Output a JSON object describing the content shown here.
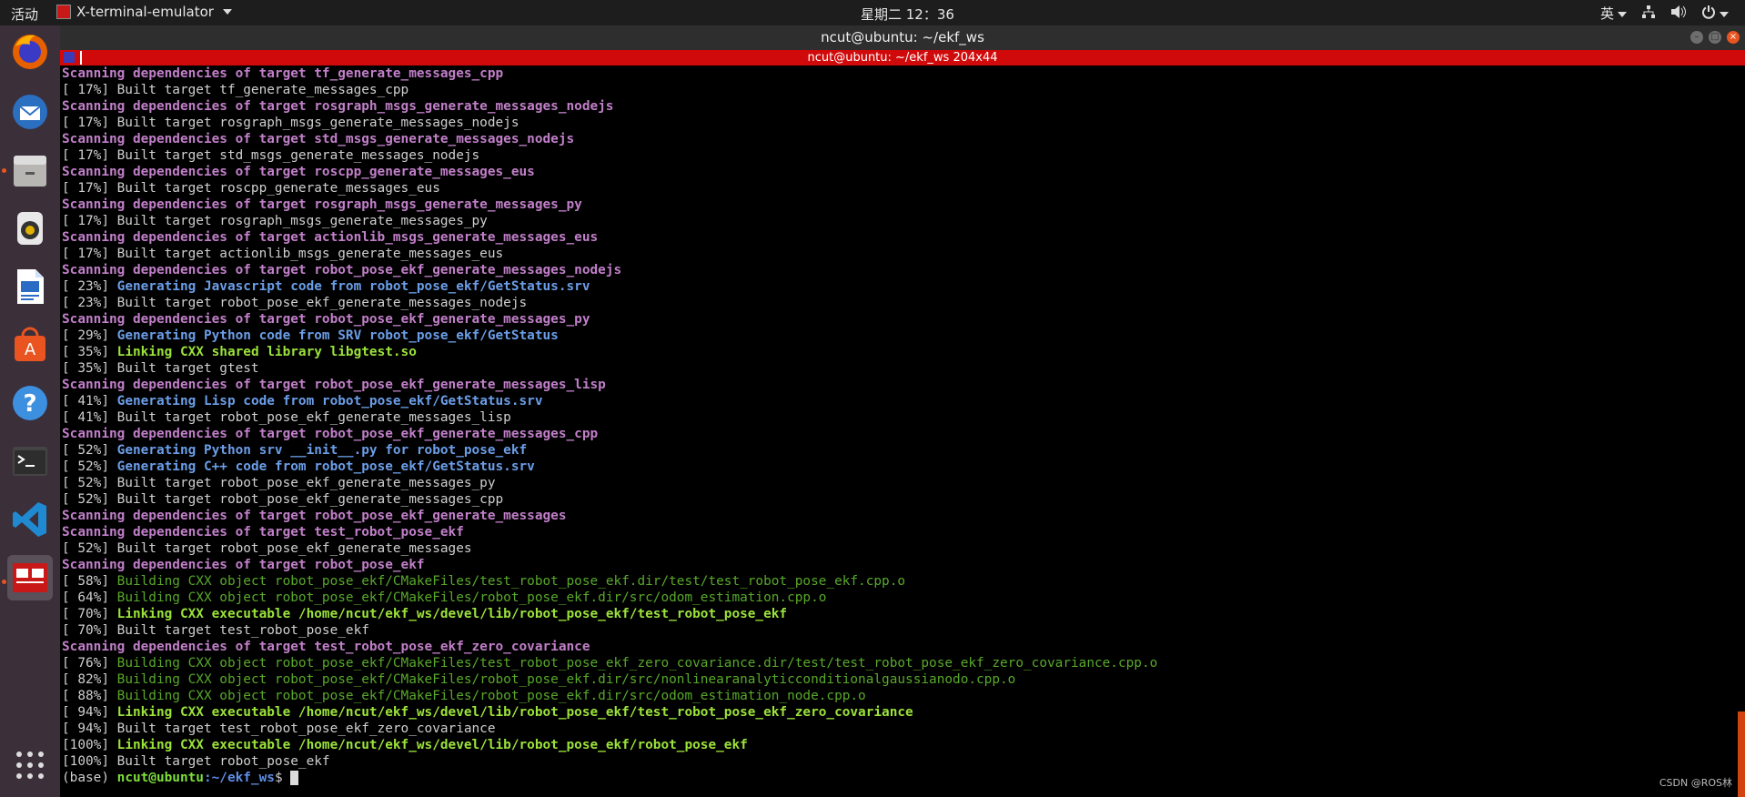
{
  "topbar": {
    "activities": "活动",
    "app_name": "X-terminal-emulator",
    "clock": "星期二 12：36",
    "input_method": "英"
  },
  "dock": {
    "items": [
      {
        "name": "firefox-icon",
        "running": false,
        "active": false
      },
      {
        "name": "thunderbird-icon",
        "running": false,
        "active": false
      },
      {
        "name": "files-icon",
        "running": true,
        "active": false
      },
      {
        "name": "rhythmbox-icon",
        "running": false,
        "active": false
      },
      {
        "name": "writer-icon",
        "running": false,
        "active": false
      },
      {
        "name": "software-icon",
        "running": false,
        "active": false
      },
      {
        "name": "help-icon",
        "running": false,
        "active": false
      },
      {
        "name": "terminal-icon",
        "running": false,
        "active": false
      },
      {
        "name": "vscode-icon",
        "running": false,
        "active": false
      },
      {
        "name": "xterm-icon",
        "running": true,
        "active": true
      }
    ],
    "apps_grid": "apps-grid-icon"
  },
  "window": {
    "title": "ncut@ubuntu: ~/ekf_ws",
    "xterm_title": "ncut@ubuntu: ~/ekf_ws 204x44"
  },
  "terminal": {
    "lines": [
      [
        {
          "t": "Scanning dependencies of target tf_generate_messages_cpp",
          "c": "scan"
        }
      ],
      [
        {
          "t": "[ 17%] Built target tf_generate_messages_cpp",
          "c": "plain"
        }
      ],
      [
        {
          "t": "Scanning dependencies of target rosgraph_msgs_generate_messages_nodejs",
          "c": "scan"
        }
      ],
      [
        {
          "t": "[ 17%] Built target rosgraph_msgs_generate_messages_nodejs",
          "c": "plain"
        }
      ],
      [
        {
          "t": "Scanning dependencies of target std_msgs_generate_messages_nodejs",
          "c": "scan"
        }
      ],
      [
        {
          "t": "[ 17%] Built target std_msgs_generate_messages_nodejs",
          "c": "plain"
        }
      ],
      [
        {
          "t": "Scanning dependencies of target roscpp_generate_messages_eus",
          "c": "scan"
        }
      ],
      [
        {
          "t": "[ 17%] Built target roscpp_generate_messages_eus",
          "c": "plain"
        }
      ],
      [
        {
          "t": "Scanning dependencies of target rosgraph_msgs_generate_messages_py",
          "c": "scan"
        }
      ],
      [
        {
          "t": "[ 17%] Built target rosgraph_msgs_generate_messages_py",
          "c": "plain"
        }
      ],
      [
        {
          "t": "Scanning dependencies of target actionlib_msgs_generate_messages_eus",
          "c": "scan"
        }
      ],
      [
        {
          "t": "[ 17%] Built target actionlib_msgs_generate_messages_eus",
          "c": "plain"
        }
      ],
      [
        {
          "t": "Scanning dependencies of target robot_pose_ekf_generate_messages_nodejs",
          "c": "scan"
        }
      ],
      [
        {
          "t": "[ 23%] ",
          "c": "plain"
        },
        {
          "t": "Generating Javascript code from robot_pose_ekf/GetStatus.srv",
          "c": "gen"
        }
      ],
      [
        {
          "t": "[ 23%] Built target robot_pose_ekf_generate_messages_nodejs",
          "c": "plain"
        }
      ],
      [
        {
          "t": "Scanning dependencies of target robot_pose_ekf_generate_messages_py",
          "c": "scan"
        }
      ],
      [
        {
          "t": "[ 29%] ",
          "c": "plain"
        },
        {
          "t": "Generating Python code from SRV robot_pose_ekf/GetStatus",
          "c": "gen"
        }
      ],
      [
        {
          "t": "[ 35%] ",
          "c": "plain"
        },
        {
          "t": "Linking CXX shared library libgtest.so",
          "c": "link"
        }
      ],
      [
        {
          "t": "[ 35%] Built target gtest",
          "c": "plain"
        }
      ],
      [
        {
          "t": "Scanning dependencies of target robot_pose_ekf_generate_messages_lisp",
          "c": "scan"
        }
      ],
      [
        {
          "t": "[ 41%] ",
          "c": "plain"
        },
        {
          "t": "Generating Lisp code from robot_pose_ekf/GetStatus.srv",
          "c": "gen"
        }
      ],
      [
        {
          "t": "[ 41%] Built target robot_pose_ekf_generate_messages_lisp",
          "c": "plain"
        }
      ],
      [
        {
          "t": "Scanning dependencies of target robot_pose_ekf_generate_messages_cpp",
          "c": "scan"
        }
      ],
      [
        {
          "t": "[ 52%] ",
          "c": "plain"
        },
        {
          "t": "Generating Python srv __init__.py for robot_pose_ekf",
          "c": "gen"
        }
      ],
      [
        {
          "t": "[ 52%] ",
          "c": "plain"
        },
        {
          "t": "Generating C++ code from robot_pose_ekf/GetStatus.srv",
          "c": "gen"
        }
      ],
      [
        {
          "t": "[ 52%] Built target robot_pose_ekf_generate_messages_py",
          "c": "plain"
        }
      ],
      [
        {
          "t": "[ 52%] Built target robot_pose_ekf_generate_messages_cpp",
          "c": "plain"
        }
      ],
      [
        {
          "t": "Scanning dependencies of target robot_pose_ekf_generate_messages",
          "c": "scan"
        }
      ],
      [
        {
          "t": "Scanning dependencies of target test_robot_pose_ekf",
          "c": "scan"
        }
      ],
      [
        {
          "t": "[ 52%] Built target robot_pose_ekf_generate_messages",
          "c": "plain"
        }
      ],
      [
        {
          "t": "Scanning dependencies of target robot_pose_ekf",
          "c": "scan"
        }
      ],
      [
        {
          "t": "[ 58%] ",
          "c": "plain"
        },
        {
          "t": "Building CXX object robot_pose_ekf/CMakeFiles/test_robot_pose_ekf.dir/test/test_robot_pose_ekf.cpp.o",
          "c": "build"
        }
      ],
      [
        {
          "t": "[ 64%] ",
          "c": "plain"
        },
        {
          "t": "Building CXX object robot_pose_ekf/CMakeFiles/robot_pose_ekf.dir/src/odom_estimation.cpp.o",
          "c": "build"
        }
      ],
      [
        {
          "t": "[ 70%] ",
          "c": "plain"
        },
        {
          "t": "Linking CXX executable /home/ncut/ekf_ws/devel/lib/robot_pose_ekf/test_robot_pose_ekf",
          "c": "link"
        }
      ],
      [
        {
          "t": "[ 70%] Built target test_robot_pose_ekf",
          "c": "plain"
        }
      ],
      [
        {
          "t": "Scanning dependencies of target test_robot_pose_ekf_zero_covariance",
          "c": "scan"
        }
      ],
      [
        {
          "t": "[ 76%] ",
          "c": "plain"
        },
        {
          "t": "Building CXX object robot_pose_ekf/CMakeFiles/test_robot_pose_ekf_zero_covariance.dir/test/test_robot_pose_ekf_zero_covariance.cpp.o",
          "c": "build"
        }
      ],
      [
        {
          "t": "[ 82%] ",
          "c": "plain"
        },
        {
          "t": "Building CXX object robot_pose_ekf/CMakeFiles/robot_pose_ekf.dir/src/nonlinearanalyticconditionalgaussianodo.cpp.o",
          "c": "build"
        }
      ],
      [
        {
          "t": "[ 88%] ",
          "c": "plain"
        },
        {
          "t": "Building CXX object robot_pose_ekf/CMakeFiles/robot_pose_ekf.dir/src/odom_estimation_node.cpp.o",
          "c": "build"
        }
      ],
      [
        {
          "t": "[ 94%] ",
          "c": "plain"
        },
        {
          "t": "Linking CXX executable /home/ncut/ekf_ws/devel/lib/robot_pose_ekf/test_robot_pose_ekf_zero_covariance",
          "c": "link"
        }
      ],
      [
        {
          "t": "[ 94%] Built target test_robot_pose_ekf_zero_covariance",
          "c": "plain"
        }
      ],
      [
        {
          "t": "[100%] ",
          "c": "plain"
        },
        {
          "t": "Linking CXX executable /home/ncut/ekf_ws/devel/lib/robot_pose_ekf/robot_pose_ekf",
          "c": "link"
        }
      ],
      [
        {
          "t": "[100%] Built target robot_pose_ekf",
          "c": "plain"
        }
      ]
    ],
    "prompt": {
      "env": "(base) ",
      "user_host": "ncut@ubuntu",
      "path": ":~/ekf_ws",
      "symbol": "$ "
    }
  },
  "watermark": "CSDN @ROS林"
}
